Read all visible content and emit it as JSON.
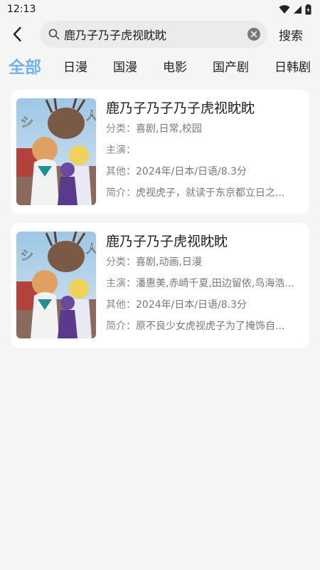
{
  "status": {
    "time": "12:13"
  },
  "search": {
    "query": "鹿乃子乃子虎视眈眈",
    "button": "搜索"
  },
  "tabs": [
    "全部",
    "日漫",
    "国漫",
    "电影",
    "国产剧",
    "日韩剧"
  ],
  "results": [
    {
      "title": "鹿乃子乃子乃子虎视眈眈",
      "category_label": "分类：",
      "category": "喜剧,日常,校园",
      "cast_label": "主演：",
      "cast": "",
      "other_label": "其他：",
      "other": "2024年/日本/日语/8.3分",
      "intro_label": "简介：",
      "intro": "虎视虎子，就读于东京都立日之..."
    },
    {
      "title": "鹿乃子乃子虎视眈眈",
      "category_label": "分类：",
      "category": "喜剧,动画,日漫",
      "cast_label": "主演：",
      "cast": "潘惠美,赤崎千夏,田边留依,鸟海浩...",
      "other_label": "其他：",
      "other": "2024年/日本/日语/8.3分",
      "intro_label": "简介：",
      "intro": "原不良少女虎视虎子为了掩饰自..."
    }
  ],
  "colors": {
    "accent": "#6fb4ef",
    "background": "#f5f5f5"
  }
}
